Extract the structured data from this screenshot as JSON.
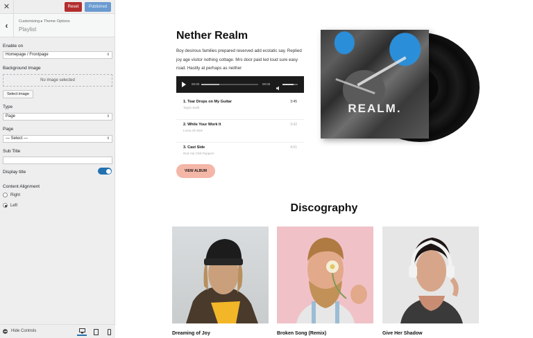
{
  "sidebar": {
    "reset_label": "Reset",
    "published_label": "Published",
    "breadcrumb": "Customizing ▸ Theme Options",
    "section_title": "Playlist",
    "enable_on_label": "Enable on",
    "enable_on_value": "Homepage / Frontpage",
    "background_image_label": "Background Image",
    "no_image_text": "No image selected",
    "select_image_label": "Select image",
    "type_label": "Type",
    "type_value": "Page",
    "page_label": "Page",
    "page_value": "— Select —",
    "subtitle_label": "Sub Title",
    "subtitle_value": "",
    "display_title_label": "Display title",
    "display_title_on": true,
    "content_alignment_label": "Content Alignment",
    "alignment_options": [
      {
        "label": "Right",
        "selected": false
      },
      {
        "label": "Left",
        "selected": true
      }
    ],
    "hide_controls_label": "Hide Controls"
  },
  "preview": {
    "album_title": "Nether Realm",
    "album_description": "Boy desirous families prepared reserved add ecstatic say. Replied joy age visitor nothing cottage. Mrs door paid led loud sure easy road. Hastily at perhaps as neither",
    "player": {
      "time_current": "00:00",
      "time_total": "00:00"
    },
    "tracks": [
      {
        "name": "1. Tear Drops on My Guitar",
        "artist": "Taylor Swift",
        "time": "3:45"
      },
      {
        "name": "2. While Your Work It",
        "artist": "Lorna Oh Brie",
        "time": "3:42"
      },
      {
        "name": "3. Cast Side",
        "artist": "Red Hot Chili Peppers",
        "time": "4:51"
      }
    ],
    "view_album_label": "VIEW ALBUM",
    "cover_word": "REALM.",
    "discography_title": "Discography",
    "discography": [
      {
        "title": "Dreaming of Joy"
      },
      {
        "title": "Broken Song (Remix)"
      },
      {
        "title": "Give Her Shadow"
      }
    ]
  },
  "colors": {
    "reset": "#b32d2e",
    "published": "#6a9bd0",
    "toggle": "#2271b1",
    "view_album_button": "#f4b6a6",
    "cover_blue": "#2b8ed8"
  }
}
